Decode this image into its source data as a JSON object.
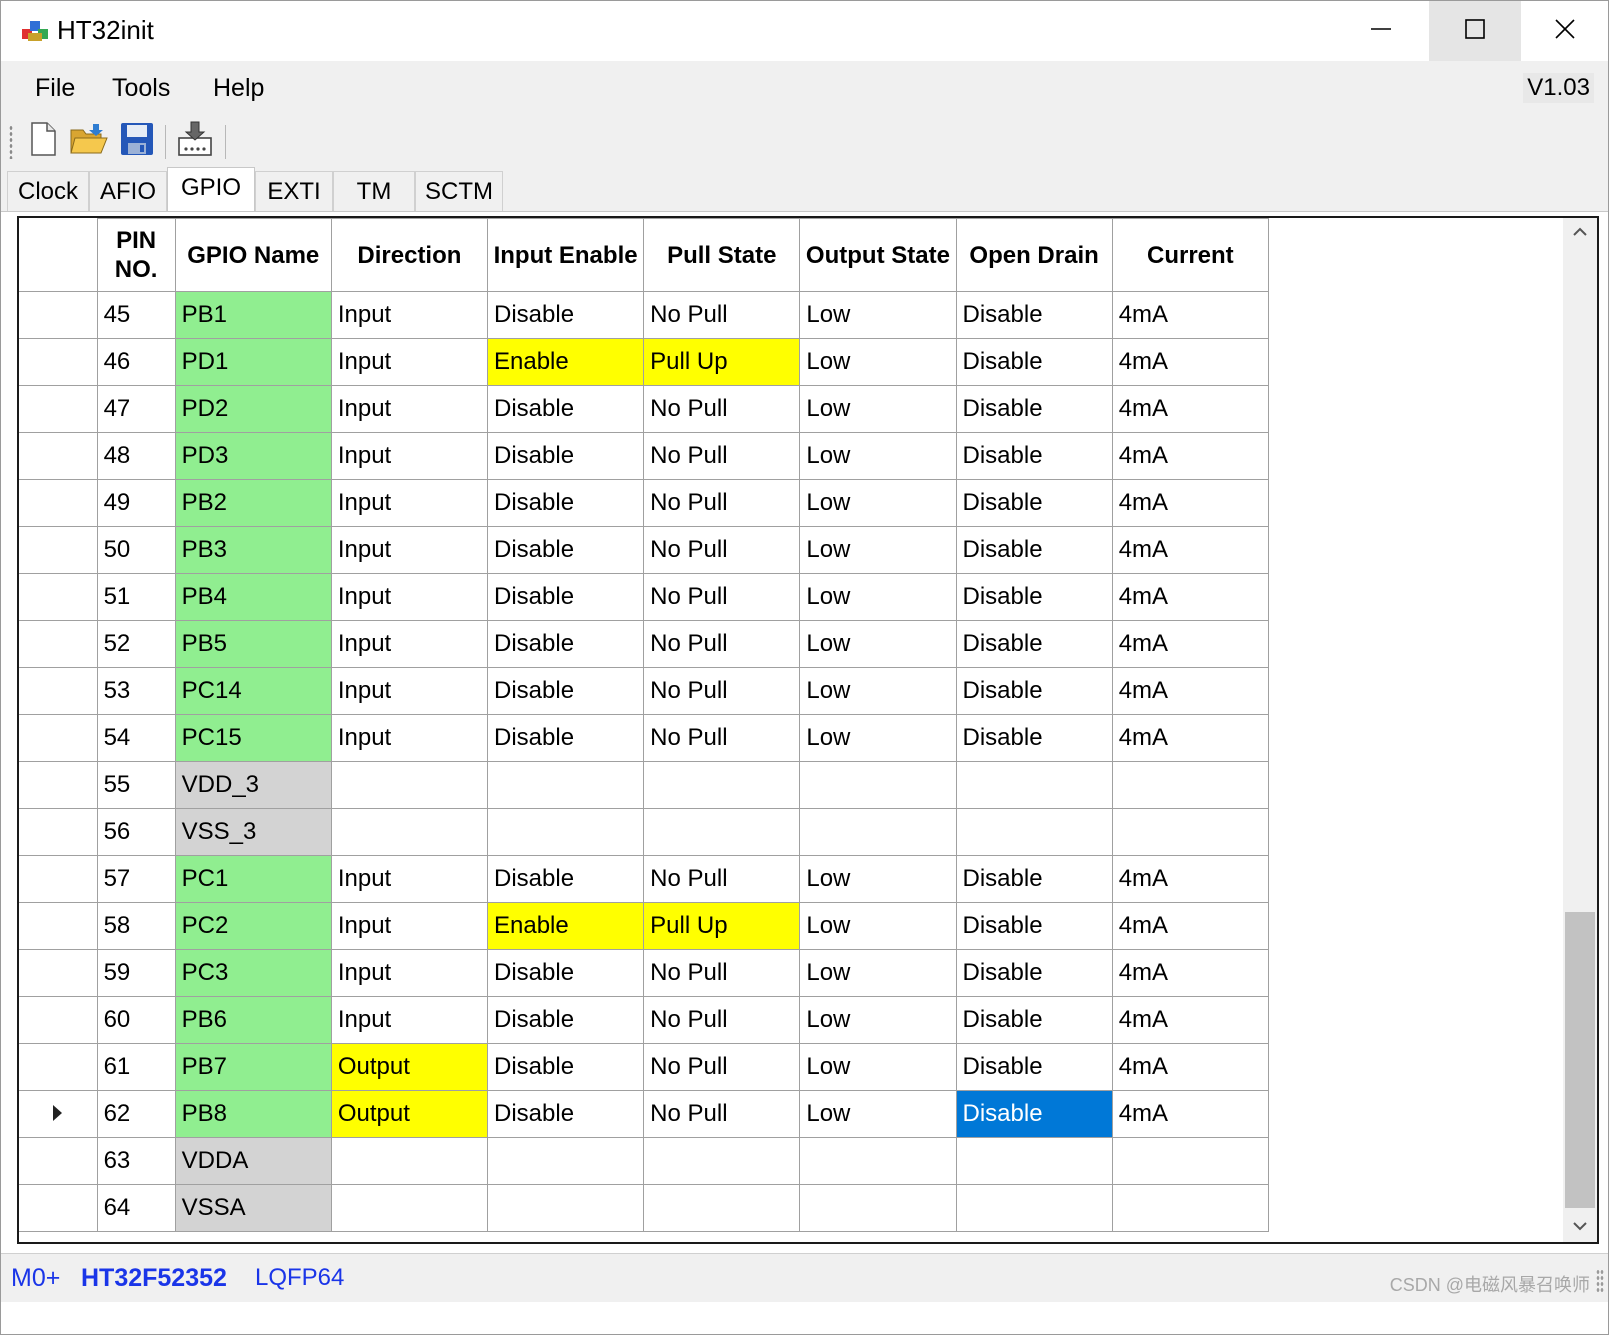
{
  "window": {
    "title": "HT32init",
    "version": "V1.03",
    "controls": {
      "minimize": "minimize-icon",
      "maximize": "maximize-icon",
      "close": "close-icon"
    }
  },
  "menu": {
    "items": [
      "File",
      "Tools",
      "Help"
    ]
  },
  "toolbar": {
    "buttons": [
      {
        "name": "new-file-icon"
      },
      {
        "name": "open-folder-icon"
      },
      {
        "name": "save-icon"
      },
      {
        "name": "generate-code-icon"
      }
    ]
  },
  "tabs": [
    {
      "label": "Clock",
      "active": false
    },
    {
      "label": "AFIO",
      "active": false
    },
    {
      "label": "GPIO",
      "active": true
    },
    {
      "label": "EXTI",
      "active": false
    },
    {
      "label": "TM",
      "active": false
    },
    {
      "label": "SCTM",
      "active": false
    }
  ],
  "grid": {
    "columns": [
      "PIN NO.",
      "GPIO Name",
      "Direction",
      "Input Enable",
      "Pull State",
      "Output State",
      "Open Drain",
      "Current"
    ],
    "rows": [
      {
        "pin": "45",
        "name": "PB1",
        "type": "gpio",
        "direction": "Input",
        "input_enable": "Disable",
        "pull": "No Pull",
        "output": "Low",
        "open_drain": "Disable",
        "current": "4mA"
      },
      {
        "pin": "46",
        "name": "PD1",
        "type": "gpio",
        "direction": "Input",
        "input_enable": "Enable",
        "pull": "Pull Up",
        "output": "Low",
        "open_drain": "Disable",
        "current": "4mA",
        "highlight": [
          "input_enable",
          "pull"
        ]
      },
      {
        "pin": "47",
        "name": "PD2",
        "type": "gpio",
        "direction": "Input",
        "input_enable": "Disable",
        "pull": "No Pull",
        "output": "Low",
        "open_drain": "Disable",
        "current": "4mA"
      },
      {
        "pin": "48",
        "name": "PD3",
        "type": "gpio",
        "direction": "Input",
        "input_enable": "Disable",
        "pull": "No Pull",
        "output": "Low",
        "open_drain": "Disable",
        "current": "4mA"
      },
      {
        "pin": "49",
        "name": "PB2",
        "type": "gpio",
        "direction": "Input",
        "input_enable": "Disable",
        "pull": "No Pull",
        "output": "Low",
        "open_drain": "Disable",
        "current": "4mA"
      },
      {
        "pin": "50",
        "name": "PB3",
        "type": "gpio",
        "direction": "Input",
        "input_enable": "Disable",
        "pull": "No Pull",
        "output": "Low",
        "open_drain": "Disable",
        "current": "4mA"
      },
      {
        "pin": "51",
        "name": "PB4",
        "type": "gpio",
        "direction": "Input",
        "input_enable": "Disable",
        "pull": "No Pull",
        "output": "Low",
        "open_drain": "Disable",
        "current": "4mA"
      },
      {
        "pin": "52",
        "name": "PB5",
        "type": "gpio",
        "direction": "Input",
        "input_enable": "Disable",
        "pull": "No Pull",
        "output": "Low",
        "open_drain": "Disable",
        "current": "4mA"
      },
      {
        "pin": "53",
        "name": "PC14",
        "type": "gpio",
        "direction": "Input",
        "input_enable": "Disable",
        "pull": "No Pull",
        "output": "Low",
        "open_drain": "Disable",
        "current": "4mA"
      },
      {
        "pin": "54",
        "name": "PC15",
        "type": "gpio",
        "direction": "Input",
        "input_enable": "Disable",
        "pull": "No Pull",
        "output": "Low",
        "open_drain": "Disable",
        "current": "4mA"
      },
      {
        "pin": "55",
        "name": "VDD_3",
        "type": "power",
        "direction": "",
        "input_enable": "",
        "pull": "",
        "output": "",
        "open_drain": "",
        "current": ""
      },
      {
        "pin": "56",
        "name": "VSS_3",
        "type": "power",
        "direction": "",
        "input_enable": "",
        "pull": "",
        "output": "",
        "open_drain": "",
        "current": ""
      },
      {
        "pin": "57",
        "name": "PC1",
        "type": "gpio",
        "direction": "Input",
        "input_enable": "Disable",
        "pull": "No Pull",
        "output": "Low",
        "open_drain": "Disable",
        "current": "4mA"
      },
      {
        "pin": "58",
        "name": "PC2",
        "type": "gpio",
        "direction": "Input",
        "input_enable": "Enable",
        "pull": "Pull Up",
        "output": "Low",
        "open_drain": "Disable",
        "current": "4mA",
        "highlight": [
          "input_enable",
          "pull"
        ]
      },
      {
        "pin": "59",
        "name": "PC3",
        "type": "gpio",
        "direction": "Input",
        "input_enable": "Disable",
        "pull": "No Pull",
        "output": "Low",
        "open_drain": "Disable",
        "current": "4mA"
      },
      {
        "pin": "60",
        "name": "PB6",
        "type": "gpio",
        "direction": "Input",
        "input_enable": "Disable",
        "pull": "No Pull",
        "output": "Low",
        "open_drain": "Disable",
        "current": "4mA"
      },
      {
        "pin": "61",
        "name": "PB7",
        "type": "gpio",
        "direction": "Output",
        "input_enable": "Disable",
        "pull": "No Pull",
        "output": "Low",
        "open_drain": "Disable",
        "current": "4mA",
        "highlight": [
          "direction"
        ]
      },
      {
        "pin": "62",
        "name": "PB8",
        "type": "gpio",
        "direction": "Output",
        "input_enable": "Disable",
        "pull": "No Pull",
        "output": "Low",
        "open_drain": "Disable",
        "current": "4mA",
        "highlight": [
          "direction"
        ],
        "current_row": true,
        "selected": "open_drain"
      },
      {
        "pin": "63",
        "name": "VDDA",
        "type": "power",
        "direction": "",
        "input_enable": "",
        "pull": "",
        "output": "",
        "open_drain": "",
        "current": ""
      },
      {
        "pin": "64",
        "name": "VSSA",
        "type": "power",
        "direction": "",
        "input_enable": "",
        "pull": "",
        "output": "",
        "open_drain": "",
        "current": ""
      }
    ]
  },
  "colors": {
    "gpio_name": "#90ee90",
    "power_name": "#d3d3d3",
    "highlight": "#ffff00",
    "selection": "#0078d7",
    "status_text": "#1a35e8"
  },
  "status": {
    "core": "M0+",
    "chip": "HT32F52352",
    "package": "LQFP64"
  },
  "watermark": "CSDN @电磁风暴召唤师"
}
